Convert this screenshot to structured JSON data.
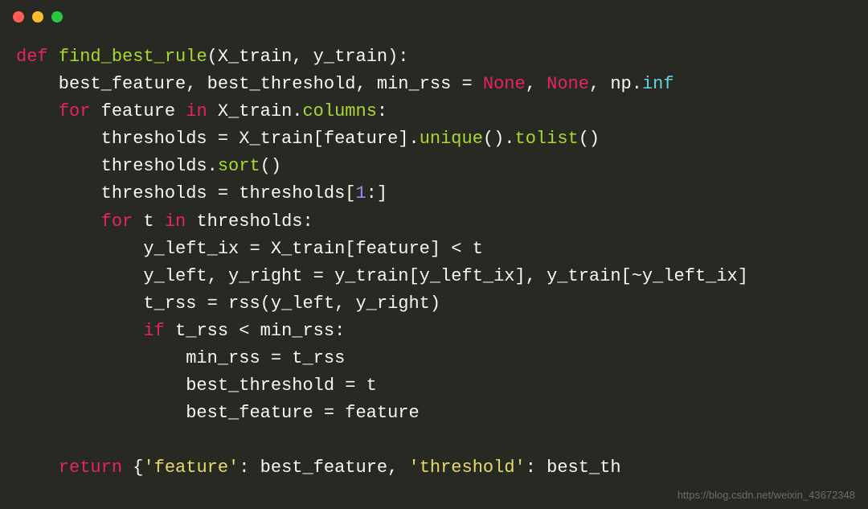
{
  "code": {
    "line1": {
      "def": "def",
      "fn": "find_best_rule",
      "rest": "(X_train, y_train):"
    },
    "line2": {
      "prefix": "    best_feature, best_threshold, min_rss = ",
      "none1": "None",
      "comma1": ", ",
      "none2": "None",
      "comma2": ", np.",
      "inf": "inf"
    },
    "line3": {
      "for": "for",
      "var": " feature ",
      "in": "in",
      "obj": " X_train.",
      "attr": "columns",
      "rest": ":"
    },
    "line4": {
      "prefix": "        thresholds = X_train[feature].",
      "m1": "unique",
      "mid": "().",
      "m2": "tolist",
      "end": "()"
    },
    "line5": {
      "prefix": "        thresholds.",
      "m": "sort",
      "end": "()"
    },
    "line6": {
      "prefix": "        thresholds = thresholds[",
      "num": "1",
      "end": ":]"
    },
    "line7": {
      "indent": "        ",
      "for": "for",
      "var": " t ",
      "in": "in",
      "rest": " thresholds:"
    },
    "line8": {
      "text": "            y_left_ix = X_train[feature] < t"
    },
    "line9": {
      "text": "            y_left, y_right = y_train[y_left_ix], y_train[~y_left_ix]"
    },
    "line10": {
      "text": "            t_rss = rss(y_left, y_right)"
    },
    "line11": {
      "indent": "            ",
      "if": "if",
      "rest": " t_rss < min_rss:"
    },
    "line12": {
      "text": "                min_rss = t_rss"
    },
    "line13": {
      "text": "                best_threshold = t"
    },
    "line14": {
      "text": "                best_feature = feature"
    },
    "line15": {
      "text": ""
    },
    "line16": {
      "indent": "    ",
      "return": "return",
      "sp": " {",
      "s1": "'feature'",
      "mid": ": best_feature, ",
      "s2": "'threshold'",
      "end": ": best_th"
    }
  },
  "watermark": "https://blog.csdn.net/weixin_43672348"
}
